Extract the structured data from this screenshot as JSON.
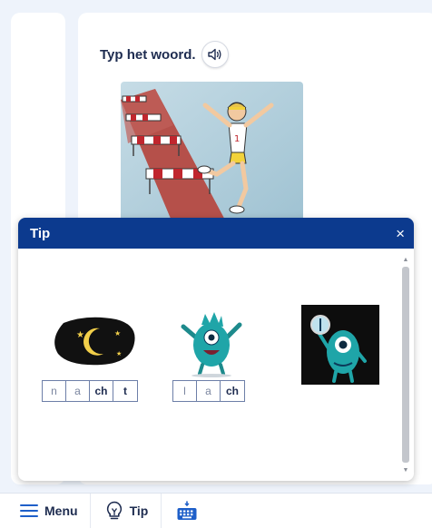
{
  "exercise": {
    "instruction": "Typ het woord."
  },
  "tip": {
    "title": "Tip",
    "close_glyph": "×",
    "words": [
      {
        "picture": "moon-night-icon",
        "letters": [
          {
            "text": "n",
            "bold": false
          },
          {
            "text": "a",
            "bold": false
          },
          {
            "text": "ch",
            "bold": true
          },
          {
            "text": "t",
            "bold": true
          }
        ]
      },
      {
        "picture": "laughing-monster-icon",
        "letters": [
          {
            "text": "l",
            "bold": false
          },
          {
            "text": "a",
            "bold": false
          },
          {
            "text": "ch",
            "bold": true
          }
        ]
      }
    ]
  },
  "toolbar": {
    "menu_label": "Menu",
    "tip_label": "Tip"
  },
  "colors": {
    "header_blue": "#0c3a8e",
    "text_dark": "#1e2c50",
    "page_bg": "#eef3fb"
  }
}
